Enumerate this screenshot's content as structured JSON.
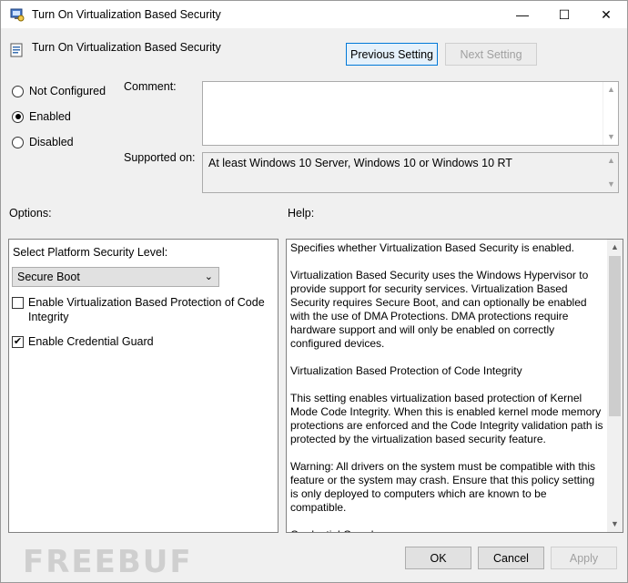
{
  "window": {
    "title": "Turn On Virtualization Based Security",
    "minimize_glyph": "—",
    "maximize_glyph": "☐",
    "close_glyph": "✕"
  },
  "policy": {
    "name": "Turn On Virtualization Based Security",
    "icon": "policy-setting-icon"
  },
  "nav": {
    "previous_label": "Previous Setting",
    "next_label": "Next Setting"
  },
  "state": {
    "options": [
      {
        "label": "Not Configured",
        "checked": false
      },
      {
        "label": "Enabled",
        "checked": true
      },
      {
        "label": "Disabled",
        "checked": false
      }
    ]
  },
  "comment": {
    "label": "Comment:",
    "value": ""
  },
  "supported": {
    "label": "Supported on:",
    "value": "At least Windows 10 Server, Windows 10 or Windows 10 RT"
  },
  "options_panel": {
    "heading": "Options:",
    "platform_label": "Select Platform Security Level:",
    "platform_value": "Secure Boot",
    "checkbox_code_integrity": "Enable Virtualization Based Protection of Code Integrity",
    "checkbox_code_integrity_checked": false,
    "checkbox_credential_guard": "Enable Credential Guard",
    "checkbox_credential_guard_checked": true
  },
  "help_panel": {
    "heading": "Help:",
    "text": "Specifies whether Virtualization Based Security is enabled.\n\nVirtualization Based Security uses the Windows Hypervisor to provide support for security services.  Virtualization Based Security requires Secure Boot, and can optionally be enabled with the use of DMA Protections.  DMA protections require hardware support and will only be enabled on correctly configured devices.\n\nVirtualization Based Protection of Code Integrity\n\nThis setting enables virtualization based protection of Kernel Mode Code Integrity. When this is enabled kernel mode memory protections are enforced and the Code Integrity validation path is protected by the virtualization based security feature.\n\nWarning: All drivers on the system must be compatible with this feature or the system may crash. Ensure that this policy setting is only deployed to computers which are known to be compatible.\n\nCredential Guard"
  },
  "footer": {
    "ok_label": "OK",
    "cancel_label": "Cancel",
    "apply_label": "Apply"
  },
  "watermark": "FREEBUF",
  "colors": {
    "accent": "#0078d7",
    "window_bg": "#f0f0f0"
  }
}
